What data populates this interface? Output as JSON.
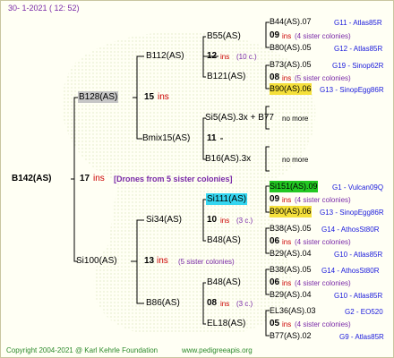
{
  "header": "30-   1-2021  ( 12: 52)",
  "footer": {
    "copyright": "Copyright 2004-2021 @ Karl Kehrle Foundation",
    "site": "www.pedigreeapis.org"
  },
  "colors": {
    "red": "#cc0000",
    "purple": "#7a2aa8",
    "blue": "#1a1adc",
    "line": "#000000",
    "green": "#22c822",
    "cyan": "#34d6f0",
    "yellow": "#f5e03a",
    "gray": "#c6c6c6"
  },
  "root": {
    "name": "B142(AS)",
    "num": "17",
    "ins": "ins",
    "note": "[Drones from 5 sister colonies]"
  },
  "gen1": [
    {
      "name": "B128(AS)",
      "num": "15",
      "ins": "ins"
    },
    {
      "name": "Si100(AS)",
      "num": "13",
      "ins": "ins",
      "note": "(5 sister colonies)"
    }
  ],
  "gen2": [
    {
      "name": "B112(AS)",
      "num": "12",
      "ins": "ins",
      "note": "(10 c.)"
    },
    {
      "name": "Bmix15(AS)",
      "num": "11",
      "ins": "",
      "note": ""
    },
    {
      "name": "Si34(AS)",
      "num": "10",
      "ins": "ins",
      "note": "(3 c.)"
    },
    {
      "name": "B86(AS)",
      "num": "08",
      "ins": "ins",
      "note": "(3 c.)"
    }
  ],
  "gen3": [
    {
      "name": "B55(AS)"
    },
    {
      "name": "B121(AS)"
    },
    {
      "name": "Si5(AS).3x + B77",
      "note": "no more"
    },
    {
      "name": "B16(AS).3x",
      "note": "no more"
    },
    {
      "name": "Si111(AS)"
    },
    {
      "name": "B48(AS)"
    },
    {
      "name": "B48(AS)"
    },
    {
      "name": "EL18(AS)"
    }
  ],
  "gen4": [
    {
      "top": "B44(AS).07",
      "top_code": "G11 - Atlas85R",
      "num": "09",
      "ins": "ins",
      "note": "(4 sister colonies)",
      "bottom": "B80(AS).05",
      "bottom_code": "G12 - Atlas85R"
    },
    {
      "top": "B73(AS).05",
      "top_code": "G19 - Sinop62R",
      "num": "08",
      "ins": "ins",
      "note": "(5 sister colonies)",
      "bottom": "B90(AS).06",
      "bottom_code": "G13 - SinopEgg86R"
    },
    {
      "top": "Si151(AS).09",
      "top_code": "G1 - Vulcan09Q",
      "num": "09",
      "ins": "ins",
      "note": "(4 sister colonies)",
      "bottom": "B90(AS).06",
      "bottom_code": "G13 - SinopEgg86R"
    },
    {
      "top": "B38(AS).05",
      "top_code": "G14 - AthosSt80R",
      "num": "06",
      "ins": "ins",
      "note": "(4 sister colonies)",
      "bottom": "B29(AS).04",
      "bottom_code": "G10 - Atlas85R"
    },
    {
      "top": "B38(AS).05",
      "top_code": "G14 - AthosSt80R",
      "num": "06",
      "ins": "ins",
      "note": "(4 sister colonies)",
      "bottom": "B29(AS).04",
      "bottom_code": "G10 - Atlas85R"
    },
    {
      "top": "EL36(AS).03",
      "top_code": "G2 - EO520",
      "num": "05",
      "ins": "ins",
      "note": "(4 sister colonies)",
      "bottom": "B77(AS).02",
      "bottom_code": "G9 - Atlas85R"
    }
  ]
}
